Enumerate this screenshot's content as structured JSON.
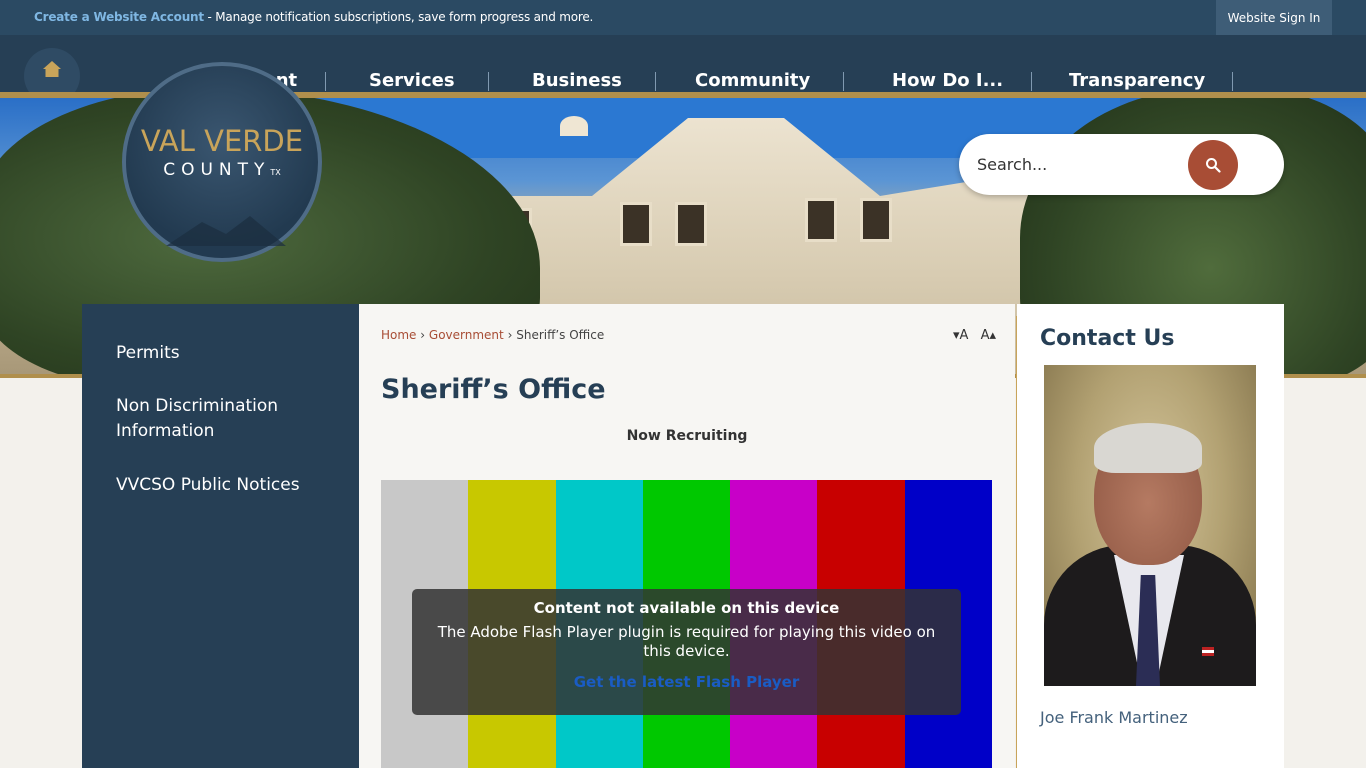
{
  "topbar": {
    "notice_link": "Create a Website Account",
    "notice_text": " - Manage notification subscriptions, save form progress and more.",
    "signin_label": "Website Sign In"
  },
  "nav": {
    "items": [
      "Government",
      "Services",
      "Business",
      "Community",
      "How Do I...",
      "Transparency"
    ]
  },
  "logo": {
    "line1": "VAL VERDE",
    "line2": "COUNTY",
    "suffix": "TX"
  },
  "search": {
    "placeholder": "Search..."
  },
  "sidebar": {
    "items": [
      {
        "label": "Permits"
      },
      {
        "label": "Non Discrimination Information"
      },
      {
        "label": "VVCSO Public Notices"
      }
    ]
  },
  "breadcrumb": {
    "home": "Home",
    "section": "Government",
    "current": "Sheriff’s Office",
    "separator": "›"
  },
  "font_controls": {
    "decrease": "▾A",
    "increase": "A▴"
  },
  "page": {
    "title": "Sheriff’s Office",
    "subheading": "Now Recruiting"
  },
  "video": {
    "bars": [
      "#c8c8c8",
      "#c8c800",
      "#00c8c8",
      "#00c800",
      "#c800c8",
      "#c80000",
      "#0000c8"
    ],
    "overlay_title": "Content not available on this device",
    "overlay_message": "The Adobe Flash Player plugin is required for playing this video on this device.",
    "overlay_link": "Get the latest Flash Player"
  },
  "contact": {
    "heading": "Contact Us",
    "name": "Joe Frank Martinez"
  },
  "colors": {
    "navy": "#263f55",
    "gold": "#b08f4c",
    "accent": "#a84d35",
    "link": "#7fb7e3"
  }
}
